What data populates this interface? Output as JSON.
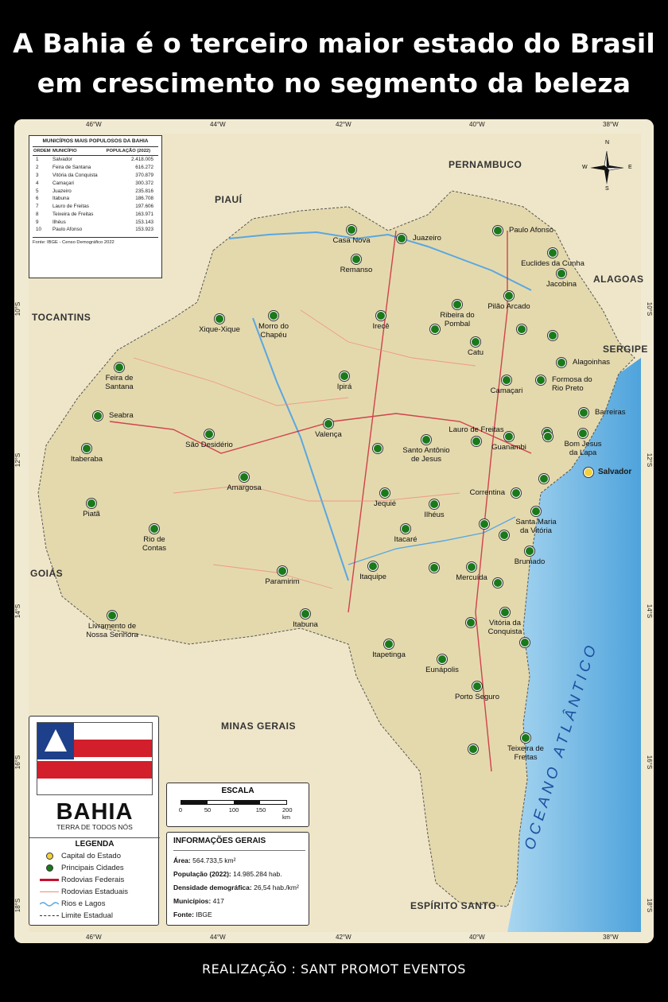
{
  "title": {
    "line1": "A Bahia é o terceiro maior estado do Brasil",
    "line2": "em crescimento no segmento da beleza"
  },
  "footer": "REALIZAÇÃO : SANT PROMOT EVENTOS",
  "colors": {
    "background": "#000000",
    "land": "#efe7cf",
    "bahia_land": "#e8ddb5",
    "ocean": "#6fb7e4",
    "city_dot": "#1a7a1a",
    "capital_dot": "#f3d13a",
    "federal_road": "#c8102e",
    "state_road": "#f08a7a",
    "river": "#5aa7e0"
  },
  "grid": {
    "longitudes": [
      "46°W",
      "44°W",
      "42°W",
      "40°W",
      "38°W"
    ],
    "latitudes": [
      "10°S",
      "12°S",
      "14°S",
      "16°S",
      "18°S"
    ]
  },
  "table": {
    "title": "MUNICÍPIOS MAIS POPULOSOS DA BAHIA",
    "headers": [
      "ORDEM",
      "MUNICÍPIO",
      "POPULAÇÃO (2022)"
    ],
    "rows": [
      [
        "1",
        "Salvador",
        "2.418.005"
      ],
      [
        "2",
        "Feira de Santana",
        "616.272"
      ],
      [
        "3",
        "Vitória da Conquista",
        "370.879"
      ],
      [
        "4",
        "Camaçari",
        "300.372"
      ],
      [
        "5",
        "Juazeiro",
        "235.816"
      ],
      [
        "6",
        "Itabuna",
        "186.708"
      ],
      [
        "7",
        "Lauro de Freitas",
        "197.606"
      ],
      [
        "8",
        "Teixeira de Freitas",
        "163.971"
      ],
      [
        "9",
        "Ilhéus",
        "153.143"
      ],
      [
        "10",
        "Paulo Afonso",
        "153.923"
      ]
    ],
    "source": "Fonte: IBGE - Censo Demográfico 2022"
  },
  "neighbors": [
    "PIAUÍ",
    "PERNAMBUCO",
    "ALAGOAS",
    "SERGIPE",
    "TOCANTINS",
    "GOIÁS",
    "MINAS GERAIS",
    "ESPÍRITO SANTO"
  ],
  "ocean_label": "OCEANO ATLÂNTICO",
  "compass": {
    "n": "N",
    "s": "S",
    "e": "E",
    "w": "W"
  },
  "capital": {
    "name": "Salvador"
  },
  "cities": [
    {
      "name": "Casa Nova"
    },
    {
      "name": "Juazeiro"
    },
    {
      "name": "Paulo Afonso"
    },
    {
      "name": "Remanso"
    },
    {
      "name": "Euclides da Cunha"
    },
    {
      "name": "Jacobina"
    },
    {
      "name": "Pilão Arcado"
    },
    {
      "name": "Xique-Xique"
    },
    {
      "name": "Morro do\nChapéu"
    },
    {
      "name": "Irecê"
    },
    {
      "name": "Ipirá"
    },
    {
      "name": "Ribeira do\nPombal"
    },
    {
      "name": "Catu"
    },
    {
      "name": "Alagoinhas"
    },
    {
      "name": "Formosa do\nRio Preto"
    },
    {
      "name": "Feira de\nSantana"
    },
    {
      "name": "Camaçari"
    },
    {
      "name": "Barreiras"
    },
    {
      "name": "Seabra"
    },
    {
      "name": "Valença"
    },
    {
      "name": "Lauro de Freitas"
    },
    {
      "name": "Bom Jesus\nda Lapa"
    },
    {
      "name": "São Desidério"
    },
    {
      "name": "Itaberaba"
    },
    {
      "name": "Santo Antônio\nde Jesus"
    },
    {
      "name": "Guanambi"
    },
    {
      "name": "Amargosa"
    },
    {
      "name": "Correntina"
    },
    {
      "name": "Piatã"
    },
    {
      "name": "Jequié"
    },
    {
      "name": "Ilhéus"
    },
    {
      "name": "Santa Maria\nda Vitória"
    },
    {
      "name": "Rio de\nContas"
    },
    {
      "name": "Itacaré"
    },
    {
      "name": "Brumado"
    },
    {
      "name": "Paramirim"
    },
    {
      "name": "Itaquipe"
    },
    {
      "name": "Mercuída"
    },
    {
      "name": "Livramento de\nNossa Senhora"
    },
    {
      "name": "Itabuna"
    },
    {
      "name": "Vitória da\nConquista"
    },
    {
      "name": "Itapetinga"
    },
    {
      "name": "Eunápolis"
    },
    {
      "name": "Porto Seguro"
    },
    {
      "name": "Teixeira de\nFreitas"
    }
  ],
  "legend_panel": {
    "state": "BAHIA",
    "motto": "TERRA DE TODOS NÓS",
    "legend_title": "LEGENDA",
    "items": [
      {
        "label": "Capital do Estado",
        "icon": "capital-dot"
      },
      {
        "label": "Principais Cidades",
        "icon": "city-dot"
      },
      {
        "label": "Rodovias Federais",
        "icon": "federal-road-line"
      },
      {
        "label": "Rodovias Estaduais",
        "icon": "state-road-line"
      },
      {
        "label": "Rios e Lagos",
        "icon": "river-wave"
      },
      {
        "label": "Limite Estadual",
        "icon": "dashed-boundary"
      }
    ]
  },
  "scale": {
    "title": "ESCALA",
    "labels": [
      "0",
      "50",
      "100",
      "150",
      "200 km"
    ]
  },
  "info": {
    "title": "INFORMAÇÕES GERAIS",
    "area_label": "Área:",
    "area_value": "564.733,5 km²",
    "pop_label": "População (2022):",
    "pop_value": "14.985.284 hab.",
    "dens_label": "Densidade demográfica:",
    "dens_value": "26,54 hab./km²",
    "mun_label": "Municípios:",
    "mun_value": "417",
    "src_label": "Fonte:",
    "src_value": "IBGE"
  }
}
